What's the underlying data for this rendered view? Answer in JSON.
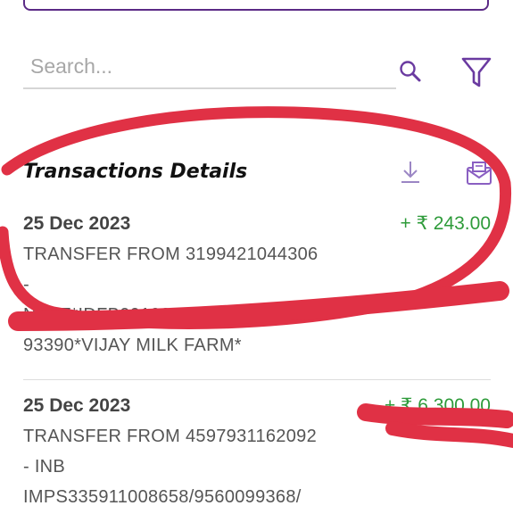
{
  "search": {
    "placeholder": "Search..."
  },
  "section": {
    "title": "Transactions Details"
  },
  "transactions": [
    {
      "date": "25 Dec 2023",
      "amount": "+ ₹  243.00",
      "lines": [
        "TRANSFER FROM 3199421044306",
        "-",
        "NEFT*IDFB0010204*FBH233591",
        "93390*VIJAY MILK FARM*"
      ]
    },
    {
      "date": "25 Dec 2023",
      "amount": "+ ₹  6,300.00",
      "lines": [
        "TRANSFER FROM 4597931162092",
        "- INB",
        "IMPS335911008658/9560099368/"
      ]
    }
  ],
  "colors": {
    "accent": "#6a3aa0",
    "amount_credit": "#2e9b3a",
    "scribble": "#e03145"
  },
  "icons": [
    "search-icon",
    "filter-icon",
    "download-icon",
    "mail-icon"
  ]
}
